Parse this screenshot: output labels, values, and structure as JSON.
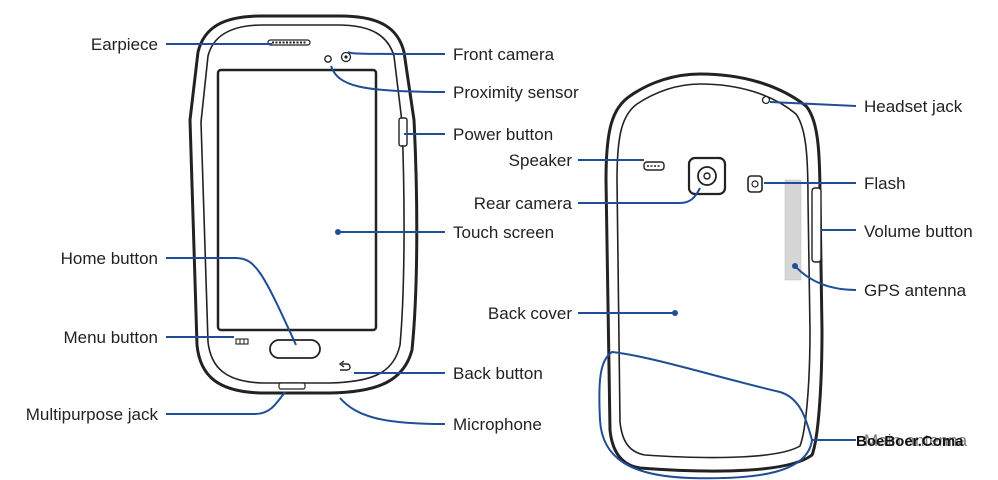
{
  "colors": {
    "leader": "#1f4e96",
    "outline": "#222222",
    "label": "#222222"
  },
  "front_labels": {
    "earpiece": "Earpiece",
    "front_camera": "Front camera",
    "proximity_sensor": "Proximity sensor",
    "power_button": "Power button",
    "touch_screen": "Touch screen",
    "home_button": "Home button",
    "menu_button": "Menu button",
    "back_button": "Back button",
    "multipurpose_jack": "Multipurpose jack",
    "microphone": "Microphone"
  },
  "back_labels": {
    "speaker": "Speaker",
    "rear_camera": "Rear camera",
    "back_cover": "Back cover",
    "headset_jack": "Headset jack",
    "flash": "Flash",
    "volume_button": "Volume button",
    "gps_antenna": "GPS antenna",
    "main_antenna": "Main antenna"
  },
  "watermark": "BoeBoer.Coma"
}
